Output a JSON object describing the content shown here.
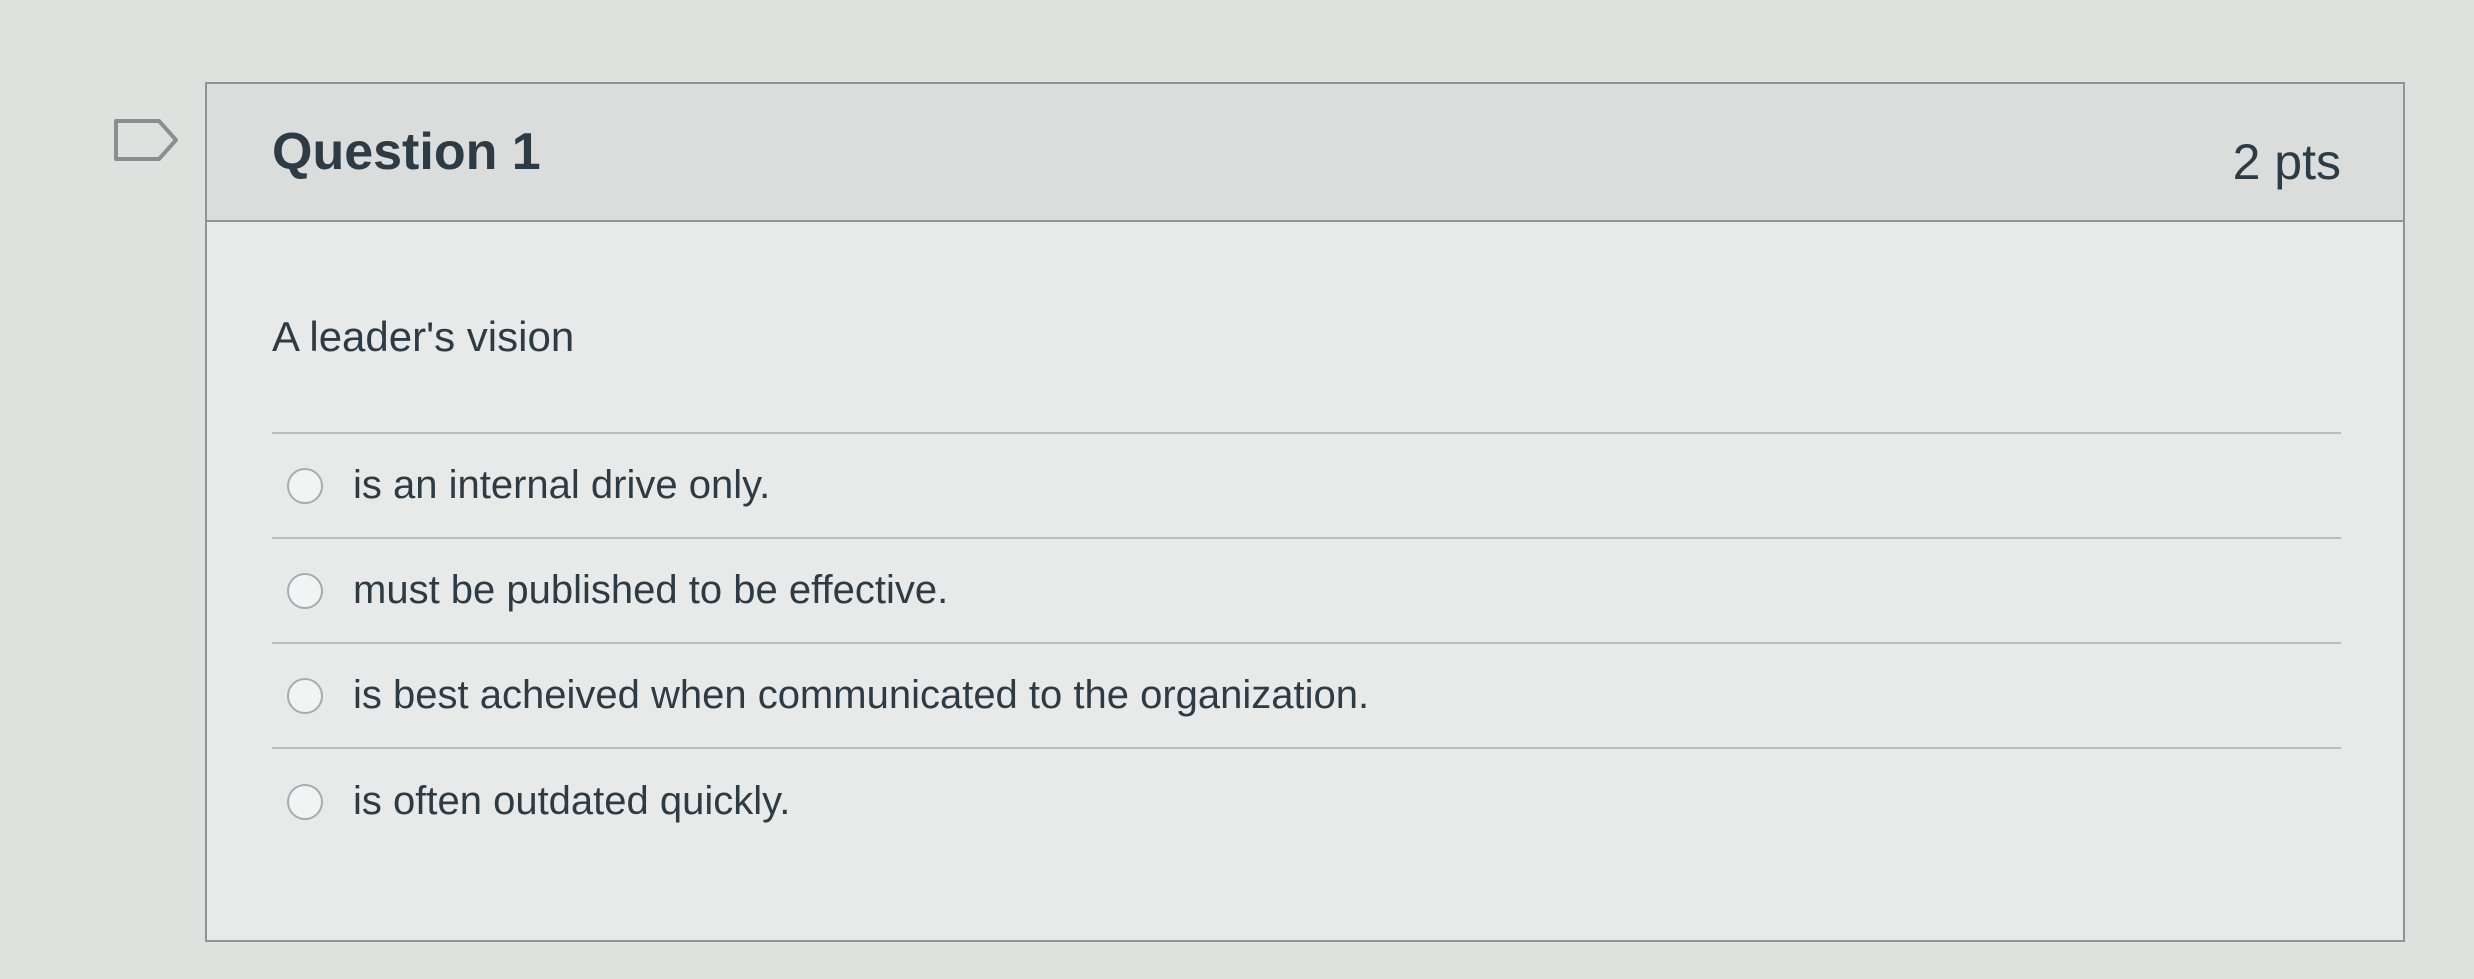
{
  "question": {
    "title": "Question 1",
    "points": "2 pts",
    "text": "A leader's vision",
    "answers": [
      {
        "label": "is an internal drive only.",
        "selected": false
      },
      {
        "label": "must be published to be effective.",
        "selected": false
      },
      {
        "label": "is best acheived when communicated to the organization.",
        "selected": false
      },
      {
        "label": "is often outdated quickly.",
        "selected": false
      }
    ]
  },
  "icons": {
    "flag": "flag-outline-icon"
  },
  "colors": {
    "text": "#2d3b45",
    "header_bg": "#dadddc",
    "body_bg": "#e8eae9",
    "border": "#8f9497"
  }
}
